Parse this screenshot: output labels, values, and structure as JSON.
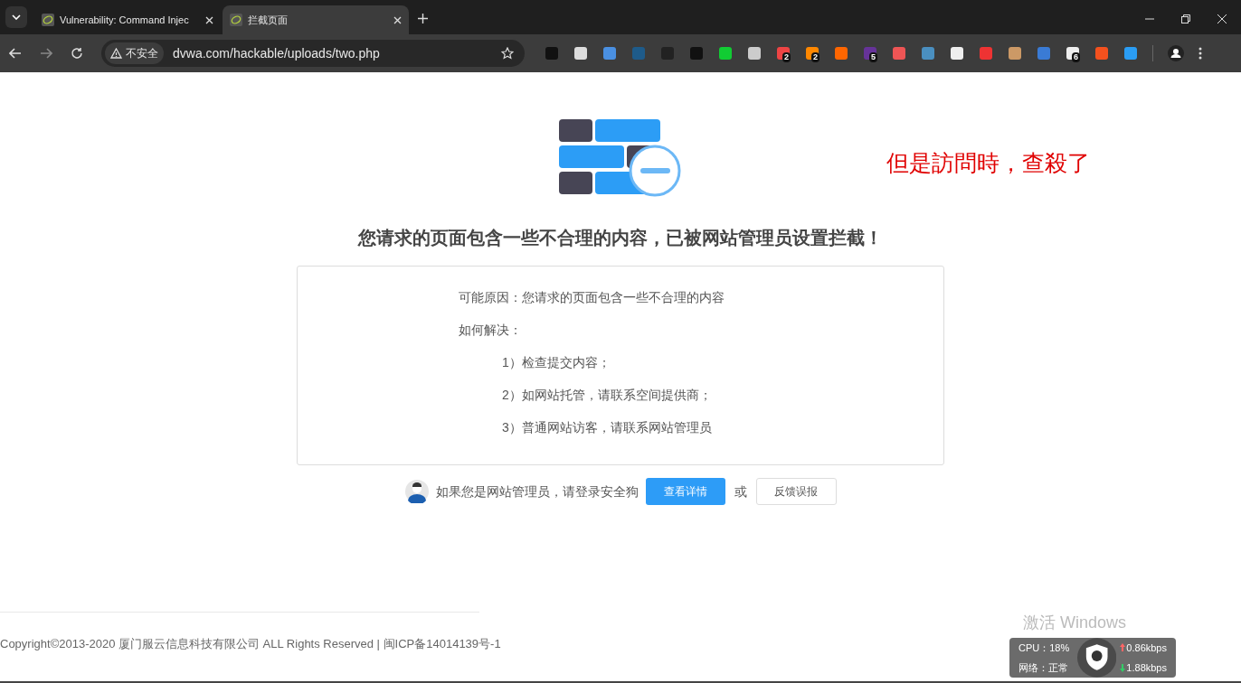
{
  "tabs": [
    {
      "title": "Vulnerability: Command Injec",
      "selected": false
    },
    {
      "title": "拦截页面",
      "selected": true
    }
  ],
  "address_bar": {
    "security_label": "不安全",
    "url": "dvwa.com/hackable/uploads/two.php"
  },
  "extension_badges": [
    "2",
    "2",
    "5",
    "6"
  ],
  "page": {
    "heading": "您请求的页面包含一些不合理的内容，已被网站管理员设置拦截！",
    "reason": "可能原因：您请求的页面包含一些不合理的内容",
    "solution_label": "如何解决：",
    "solutions": [
      "1）检查提交内容；",
      "2）如网站托管，请联系空间提供商；",
      "3）普通网站访客，请联系网站管理员"
    ],
    "admin_prompt": "如果您是网站管理员，请登录安全狗",
    "details_button": "查看详情",
    "or_text": "或",
    "feedback_button": "反馈误报",
    "copyright": "Copyright©2013-2020 厦门服云信息科技有限公司 ALL Rights Reserved | 闽ICP备14014139号-1"
  },
  "annotation": "但是訪問時，查殺了",
  "activation_notice": "激活 Windows",
  "monitor": {
    "cpu": "CPU：18%",
    "network": "网络：正常",
    "upload": "0.86kbps",
    "download": "1.88kbps"
  }
}
